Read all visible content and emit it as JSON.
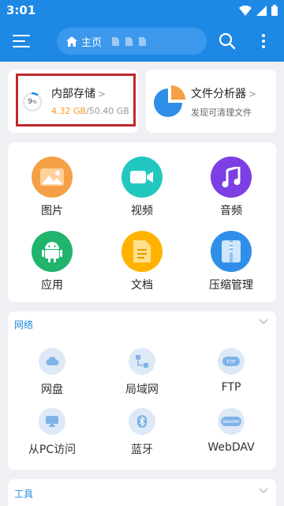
{
  "status": {
    "time": "3:01"
  },
  "header": {
    "home_tab": "主页"
  },
  "storage": {
    "title": "内部存储",
    "used": "4.32 GB",
    "total": "/50.40 GB",
    "percent_label": "9",
    "percent_sign": "%",
    "used_fraction": 0.09
  },
  "analyzer": {
    "title": "文件分析器",
    "subtitle": "发现可清理文件"
  },
  "categories": [
    {
      "label": "图片",
      "icon": "image-icon",
      "color": "#f5a047"
    },
    {
      "label": "视频",
      "icon": "video-icon",
      "color": "#22c8c0"
    },
    {
      "label": "音频",
      "icon": "music-icon",
      "color": "#7b3fe4"
    },
    {
      "label": "应用",
      "icon": "android-icon",
      "color": "#20b46c"
    },
    {
      "label": "文档",
      "icon": "document-icon",
      "color": "#ffb300"
    },
    {
      "label": "压缩管理",
      "icon": "archive-icon",
      "color": "#2f8fe8"
    }
  ],
  "network": {
    "title": "网络",
    "items": [
      {
        "label": "网盘",
        "icon": "cloud-drive-icon"
      },
      {
        "label": "局域网",
        "icon": "lan-icon"
      },
      {
        "label": "FTP",
        "icon": "ftp-icon"
      },
      {
        "label": "从PC访问",
        "icon": "pc-access-icon"
      },
      {
        "label": "蓝牙",
        "icon": "bluetooth-icon"
      },
      {
        "label": "WebDAV",
        "icon": "webdav-icon"
      }
    ]
  },
  "tools": {
    "title": "工具"
  },
  "colors": {
    "accent": "#1e88e5",
    "storage_used": "#f59a23",
    "highlight": "#c1272d"
  }
}
